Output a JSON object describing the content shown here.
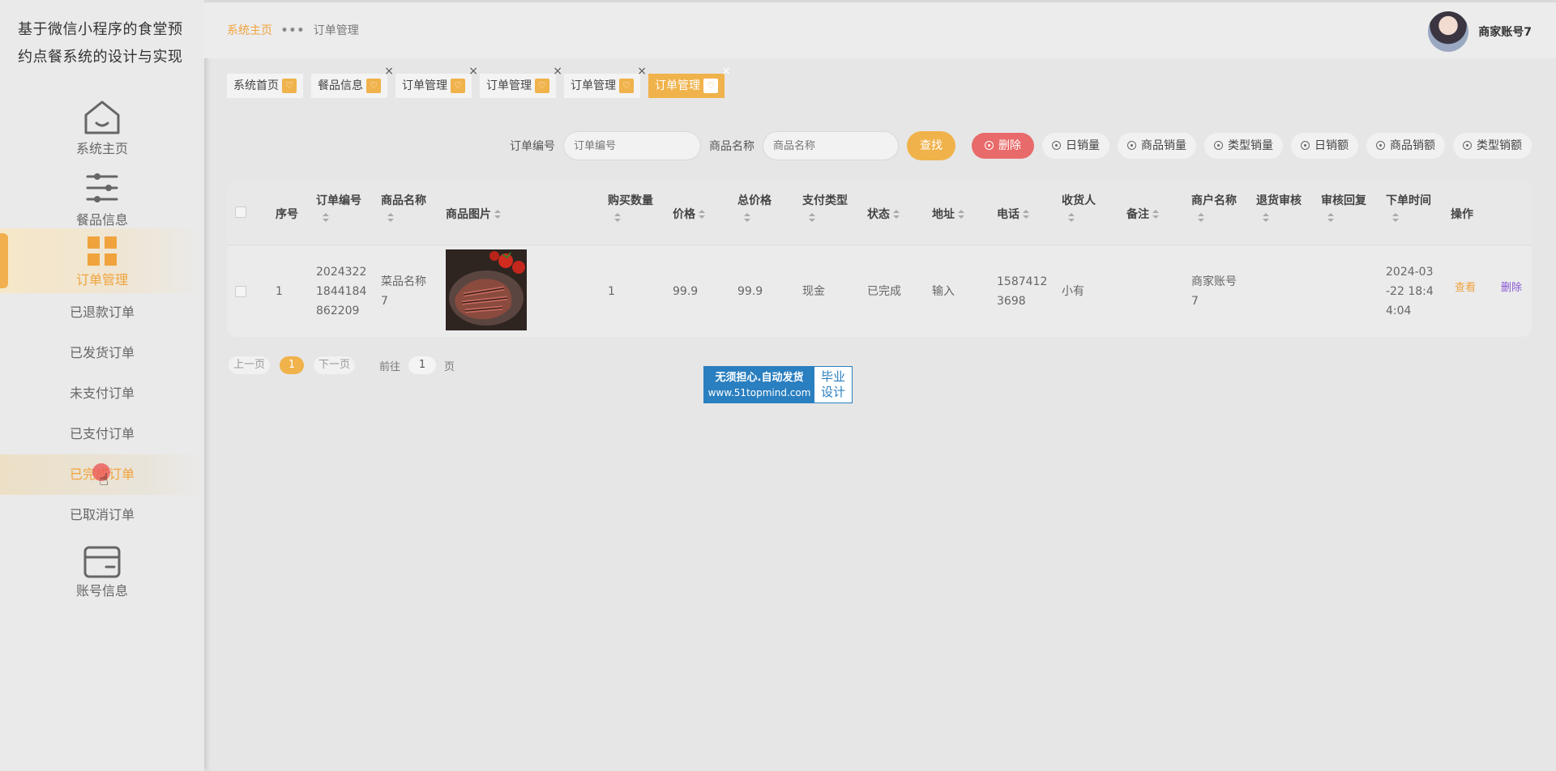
{
  "app": {
    "title": "基于微信小程序的食堂预约点餐系统的设计与实现"
  },
  "sidebar": {
    "home": {
      "label": "系统主页",
      "icon": "home-icon"
    },
    "food": {
      "label": "餐品信息",
      "icon": "sliders-icon"
    },
    "orders": {
      "label": "订单管理",
      "icon": "grid-icon",
      "sub_items": [
        {
          "label": "已退款订单"
        },
        {
          "label": "已发货订单"
        },
        {
          "label": "未支付订单"
        },
        {
          "label": "已支付订单"
        },
        {
          "label": "已完成订单"
        },
        {
          "label": "已取消订单"
        }
      ]
    },
    "account": {
      "label": "账号信息",
      "icon": "card-icon"
    }
  },
  "header": {
    "breadcrumb": {
      "home": "系统主页",
      "separator": "•••",
      "current": "订单管理"
    },
    "user_name": "商家账号7"
  },
  "tabs": [
    {
      "label": "系统首页",
      "closable": false
    },
    {
      "label": "餐品信息",
      "closable": true
    },
    {
      "label": "订单管理",
      "closable": true
    },
    {
      "label": "订单管理",
      "closable": true
    },
    {
      "label": "订单管理",
      "closable": true
    },
    {
      "label": "订单管理",
      "closable": true,
      "active": true
    }
  ],
  "search": {
    "order_no_label": "订单编号",
    "order_no_placeholder": "订单编号",
    "product_label": "商品名称",
    "product_placeholder": "商品名称",
    "find_button": "查找",
    "delete_button": "删除",
    "stat_buttons": [
      "日销量",
      "商品销量",
      "类型销量",
      "日销额",
      "商品销额",
      "类型销额"
    ]
  },
  "table": {
    "headers": [
      "序号",
      "订单编号",
      "商品名称",
      "商品图片",
      "购买数量",
      "价格",
      "总价格",
      "支付类型",
      "状态",
      "地址",
      "电话",
      "收货人",
      "备注",
      "商户名称",
      "退货审核",
      "审核回复",
      "下单时间",
      "操作"
    ],
    "rows": [
      {
        "index": "1",
        "order_no": [
          "2024322",
          "1844184",
          "862209"
        ],
        "product_name": [
          "菜品名称",
          "7"
        ],
        "quantity": "1",
        "price": "99.9",
        "total": "99.9",
        "pay_type": "现金",
        "status": "已完成",
        "address": "输入",
        "phone": [
          "1587412",
          "3698"
        ],
        "receiver": "小有",
        "remark": "",
        "merchant": [
          "商家账号",
          "7"
        ],
        "return_review": "",
        "review_reply": "",
        "order_time": [
          "2024-03",
          "-22 18:4",
          "4:04"
        ],
        "action_view": "查看",
        "action_delete": "删除"
      }
    ]
  },
  "pagination": {
    "prev": "上一页",
    "current": "1",
    "next": "下一页",
    "goto_label": "前往",
    "goto_value": "1",
    "page_unit": "页"
  },
  "watermark": {
    "line1": "无须担心.自动发货",
    "line2": "www.51topmind.com",
    "side1": "毕业",
    "side2": "设计"
  },
  "colors": {
    "accent": "#f0b24a",
    "danger": "#e96a6a",
    "link_purple": "#8a58d6",
    "watermark_blue": "#2a7fc0"
  }
}
